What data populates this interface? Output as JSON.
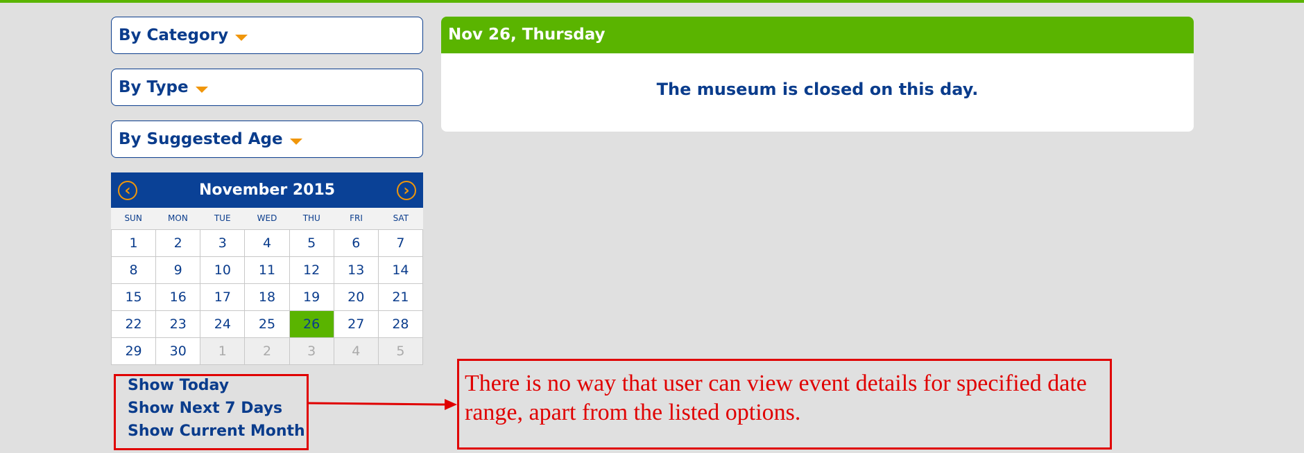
{
  "filters": [
    {
      "label": "By Category"
    },
    {
      "label": "By Type"
    },
    {
      "label": "By Suggested Age"
    }
  ],
  "calendar": {
    "title": "November 2015",
    "prev_icon": "chevron-left-icon",
    "next_icon": "chevron-right-icon",
    "weekdays": [
      "SUN",
      "MON",
      "TUE",
      "WED",
      "THU",
      "FRI",
      "SAT"
    ],
    "weeks": [
      [
        "1",
        "2",
        "3",
        "4",
        "5",
        "6",
        "7"
      ],
      [
        "8",
        "9",
        "10",
        "11",
        "12",
        "13",
        "14"
      ],
      [
        "15",
        "16",
        "17",
        "18",
        "19",
        "20",
        "21"
      ],
      [
        "22",
        "23",
        "24",
        "25",
        "26",
        "27",
        "28"
      ],
      [
        "29",
        "30",
        "1",
        "2",
        "3",
        "4",
        "5"
      ]
    ],
    "selected_day": "26",
    "next_month_days_in_last_row": 5
  },
  "quick_links": {
    "today": "Show Today",
    "next7": "Show Next 7 Days",
    "month": "Show Current Month"
  },
  "day_panel": {
    "heading": "Nov 26, Thursday",
    "message": "The museum is closed on this day."
  },
  "annotation": {
    "note": "There is no way that user can view event details for specified date range, apart from the listed options."
  },
  "colors": {
    "accent_green": "#5ab400",
    "brand_blue": "#0a3c8c",
    "header_blue": "#0a4196",
    "caret_orange": "#f0960a",
    "annotation_red": "#e00000",
    "background": "#e0e0e0"
  }
}
